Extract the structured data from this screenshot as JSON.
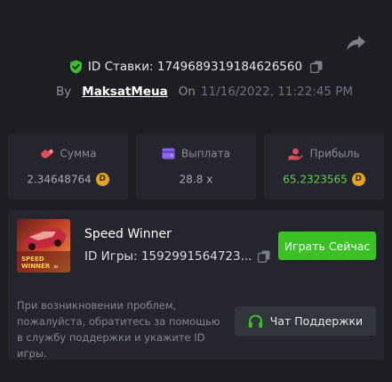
{
  "bet": {
    "id_label": "ID Ставки:",
    "id_value": "1749689319184626560",
    "by_label": "By",
    "username": "MaksatMeua",
    "on_label": "On",
    "datetime": "11/16/2022, 11:22:45 PM"
  },
  "stats": [
    {
      "label": "Сумма",
      "value": "2.34648764",
      "icon": "money-bag-icon",
      "currency": "D"
    },
    {
      "label": "Выплата",
      "value": "28.8 x",
      "icon": "wallet-icon"
    },
    {
      "label": "Прибыль",
      "value": "65.2323565",
      "icon": "profit-hand-icon",
      "currency": "D"
    }
  ],
  "game": {
    "title": "Speed Winner",
    "id_label": "ID Игры:",
    "id_value": "1592991564723...",
    "thumbnail_text_1": "SPEED",
    "thumbnail_text_2": "WINNER",
    "thumbnail_text_3": ".io",
    "play_label": "Играть Сейчас"
  },
  "support": {
    "help_text": "При возникновении проблем, пожалуйста, обратитесь за помощью в службу поддержки и укажите ID игры.",
    "button_label": "Чат Поддержки"
  },
  "colors": {
    "background": "#1d1e23",
    "card": "#25262d",
    "accent_green": "#3bc123",
    "profit_green": "#5fce4a",
    "coin": "#e3a326",
    "stat_icon_red": "#e64b5a",
    "stat_icon_purple": "#8b63f2"
  }
}
